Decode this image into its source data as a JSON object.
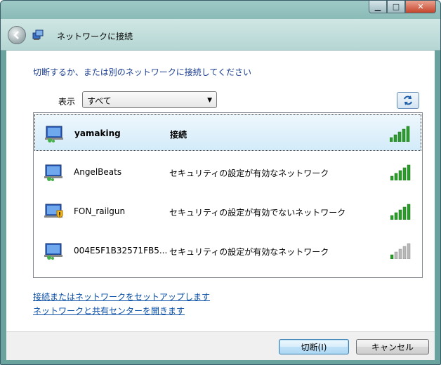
{
  "window": {
    "caption_buttons": {
      "minimize": "▁",
      "maximize": "□",
      "close": "✕"
    }
  },
  "nav": {
    "title": "ネットワークに接続"
  },
  "content": {
    "heading": "切断するか、または別のネットワークに接続してください",
    "show_label": "表示",
    "show_select_value": "すべて"
  },
  "networks": [
    {
      "ssid": "yamaking",
      "status": "接続",
      "signal_bars": 5,
      "secure": true,
      "selected": true
    },
    {
      "ssid": "AngelBeats",
      "status": "セキュリティの設定が有効なネットワーク",
      "signal_bars": 5,
      "secure": true,
      "selected": false
    },
    {
      "ssid": "FON_railgun",
      "status": "セキュリティの設定が有効でないネットワーク",
      "signal_bars": 5,
      "secure": false,
      "selected": false
    },
    {
      "ssid": "004E5F1B32571FB5...",
      "status": "セキュリティの設定が有効なネットワーク",
      "signal_bars": 1,
      "secure": true,
      "selected": false
    }
  ],
  "links": {
    "setup": "接続またはネットワークをセットアップします",
    "center": "ネットワークと共有センターを開きます"
  },
  "footer": {
    "disconnect": "切断(I)",
    "cancel": "キャンセル"
  }
}
